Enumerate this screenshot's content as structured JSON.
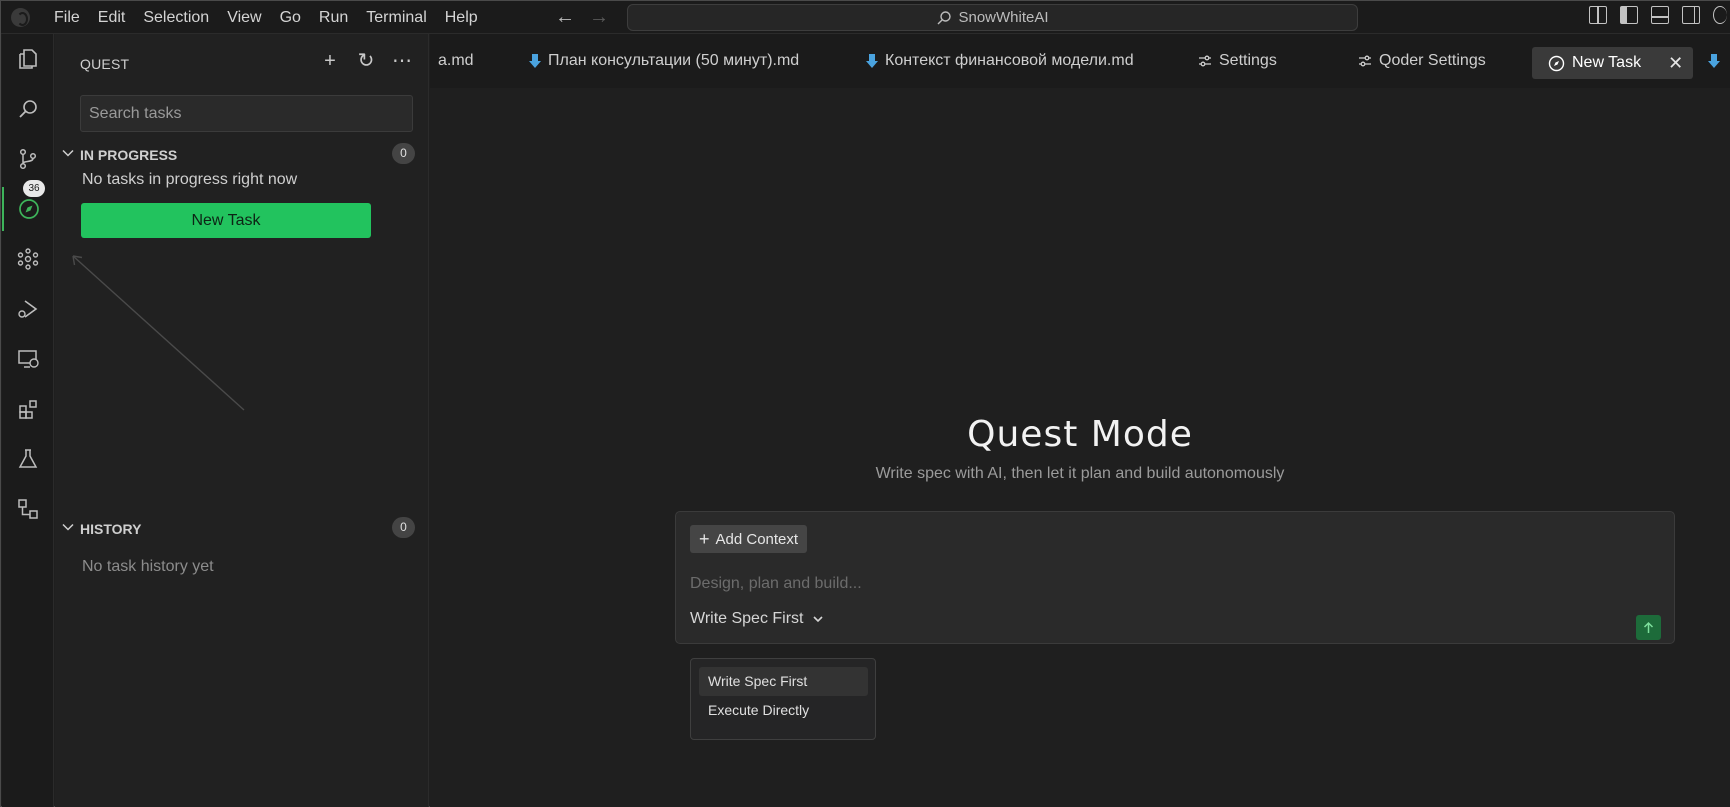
{
  "titlebar": {
    "menu": [
      "File",
      "Edit",
      "Selection",
      "View",
      "Go",
      "Run",
      "Terminal",
      "Help"
    ],
    "search_label": "SnowWhiteAI"
  },
  "activity": {
    "scm_badge": "36"
  },
  "sidebar": {
    "title": "QUEST",
    "search_placeholder": "Search tasks",
    "in_progress": {
      "label": "IN PROGRESS",
      "count": "0",
      "empty_text": "No tasks in progress right now"
    },
    "new_task_label": "New Task",
    "history": {
      "label": "HISTORY",
      "count": "0",
      "empty_text": "No task history yet"
    }
  },
  "tabs": [
    {
      "label": "a.md",
      "icon": "markdown-icon"
    },
    {
      "label": "План консультации (50 минут).md",
      "icon": "markdown-icon"
    },
    {
      "label": "Контекст финансовой модели.md",
      "icon": "markdown-icon"
    },
    {
      "label": "Settings",
      "icon": "settings-sliders-icon"
    },
    {
      "label": "Qoder Settings",
      "icon": "settings-sliders-icon"
    },
    {
      "label": "New Task",
      "icon": "compass-icon",
      "active": true
    }
  ],
  "main": {
    "title": "Quest Mode",
    "subtitle": "Write spec with AI, then let it plan and build autonomously",
    "add_context_label": "Add Context",
    "input_placeholder": "Design, plan and build...",
    "mode_selected": "Write Spec First",
    "mode_options": [
      "Write Spec First",
      "Execute Directly"
    ]
  },
  "colors": {
    "accent": "#22c35e",
    "background": "#1f1f1f",
    "sidebar": "#212121"
  }
}
